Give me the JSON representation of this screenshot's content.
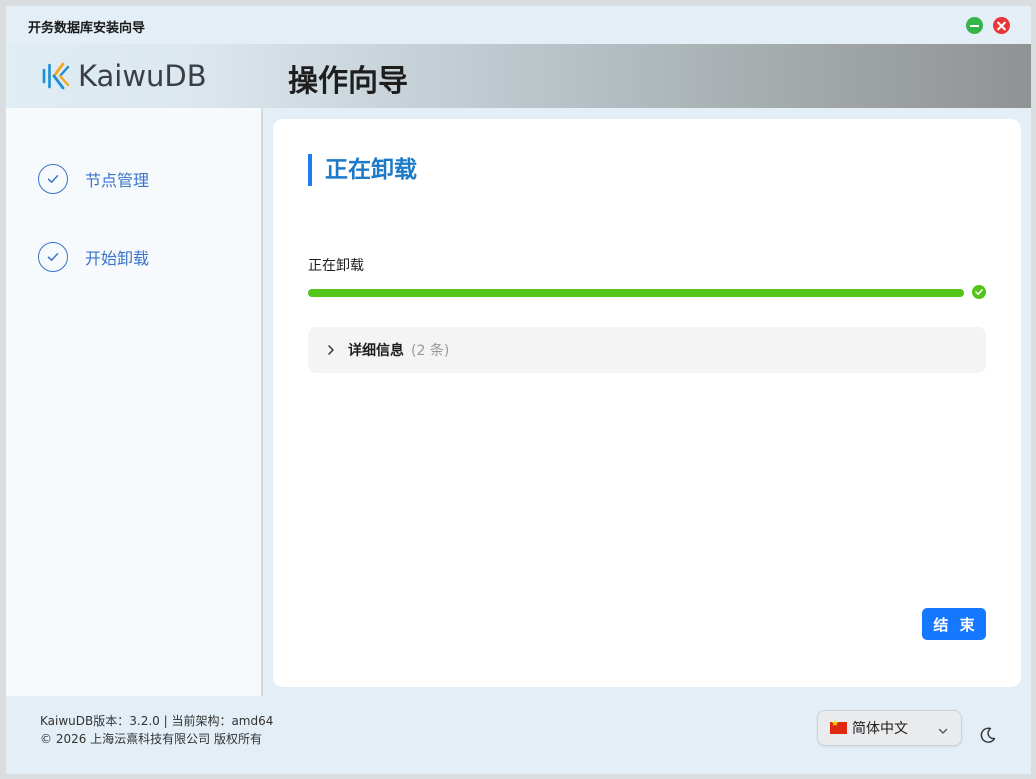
{
  "window": {
    "title": "开务数据库安装向导"
  },
  "header": {
    "logo_text": "KaiwuDB",
    "page_title": "操作向导"
  },
  "sidebar": {
    "steps": [
      {
        "label": "节点管理",
        "status": "completed"
      },
      {
        "label": "开始卸载",
        "status": "completed"
      }
    ]
  },
  "main": {
    "section_title": "正在卸载",
    "progress": {
      "label": "正在卸载",
      "percent": 100,
      "status": "success"
    },
    "details": {
      "title": "详细信息",
      "count": "(2 条)",
      "expanded": false
    },
    "finish_label": "结 束"
  },
  "footer": {
    "version_line": "KaiwuDB版本：3.2.0 | 当前架构：amd64",
    "copyright_line": "© 2026 上海沄熹科技有限公司 版权所有",
    "language": {
      "selected": "简体中文",
      "flag_icon": "china-flag-icon"
    },
    "theme_icon": "moon-icon"
  },
  "colors": {
    "accent": "#1677ff",
    "step_blue": "#3a74c9",
    "progress_green": "#52c41a",
    "title_blue": "#1c7ac9",
    "close_red": "#e8373a",
    "minimize_green": "#34b54a"
  }
}
